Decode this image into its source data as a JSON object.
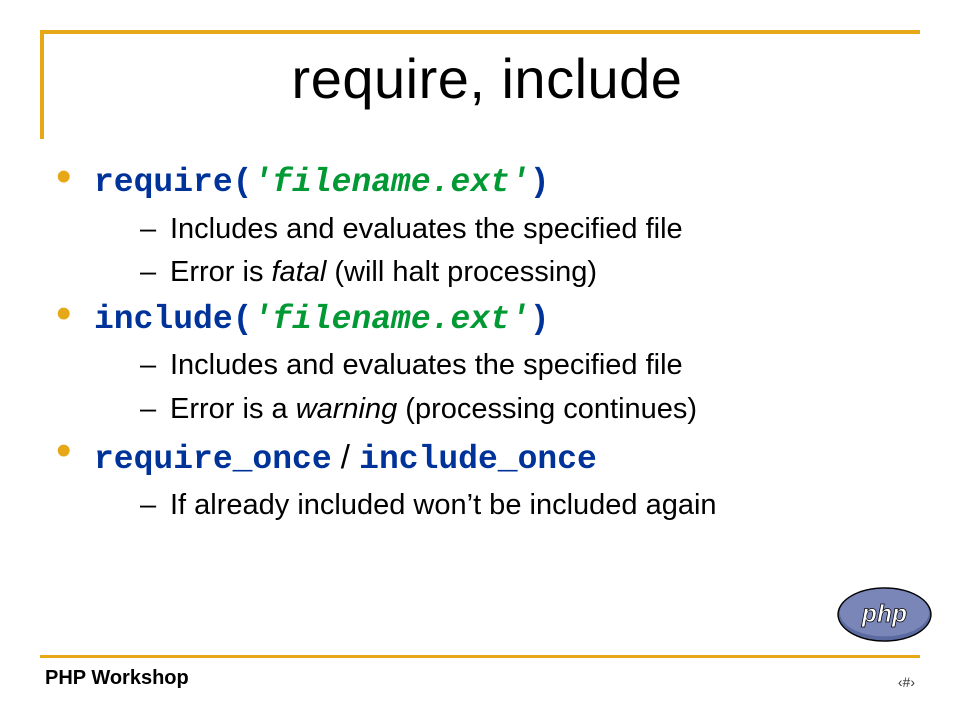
{
  "title": "require, include",
  "bullets": [
    {
      "code_fn": "require(",
      "code_arg": "'filename.ext'",
      "code_end": ")",
      "sub": [
        {
          "text_pre": "Includes and evaluates the specified file",
          "ital": "",
          "text_post": ""
        },
        {
          "text_pre": "Error is ",
          "ital": "fatal",
          "text_post": " (will halt processing)"
        }
      ]
    },
    {
      "code_fn": "include(",
      "code_arg": "'filename.ext'",
      "code_end": ")",
      "sub": [
        {
          "text_pre": "Includes and evaluates the specified file",
          "ital": "",
          "text_post": ""
        },
        {
          "text_pre": "Error is a ",
          "ital": "warning",
          "text_post": " (processing continues)"
        }
      ]
    },
    {
      "code_a": "require_once",
      "sep": " / ",
      "code_b": "include_once",
      "sub": [
        {
          "text_pre": "If already included won’t be included again",
          "ital": "",
          "text_post": ""
        }
      ]
    }
  ],
  "footer": {
    "left": "PHP Workshop",
    "right": "‹#›"
  },
  "logo": {
    "text": "php"
  }
}
